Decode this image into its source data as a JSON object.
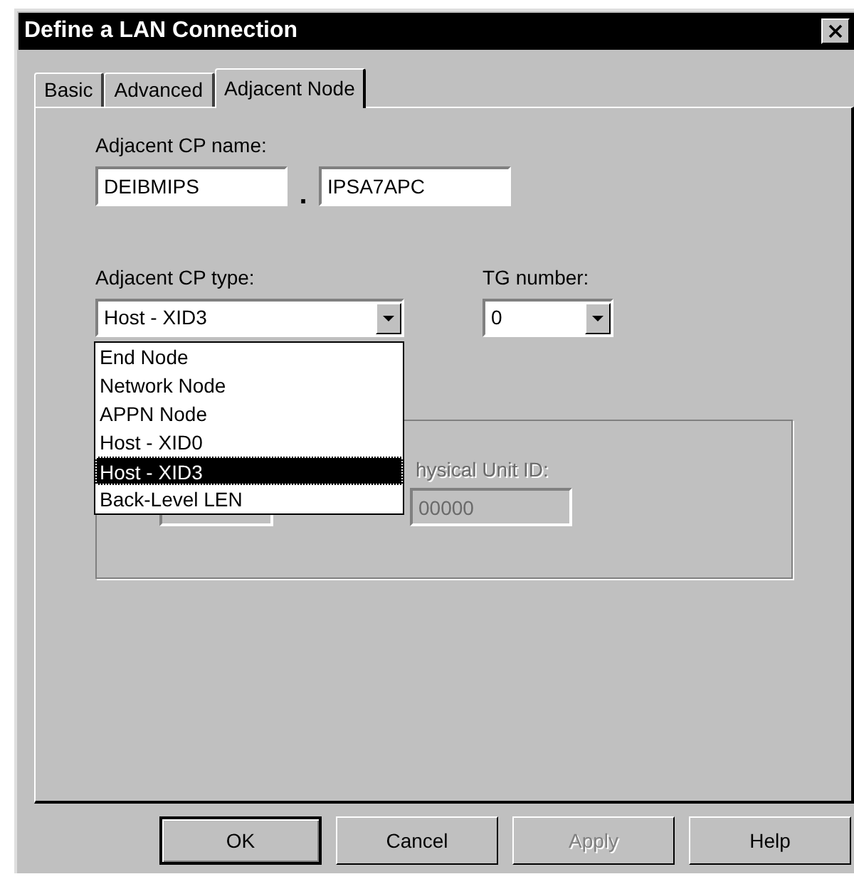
{
  "window": {
    "title": "Define a LAN Connection"
  },
  "tabs": [
    {
      "label": "Basic",
      "selected": false
    },
    {
      "label": "Advanced",
      "selected": false
    },
    {
      "label": "Adjacent Node",
      "selected": true
    }
  ],
  "cp_name": {
    "label": "Adjacent CP name:",
    "network": "DEIBMIPS",
    "separator": ".",
    "name": "IPSA7APC"
  },
  "cp_type": {
    "label": "Adjacent CP type:",
    "value": "Host - XID3",
    "expanded": true,
    "options": [
      {
        "label": "End Node",
        "selected": false
      },
      {
        "label": "Network Node",
        "selected": false
      },
      {
        "label": "APPN Node",
        "selected": false
      },
      {
        "label": "Host - XID0",
        "selected": false
      },
      {
        "label": "Host - XID3",
        "selected": true
      },
      {
        "label": "Back-Level LEN",
        "selected": false
      }
    ]
  },
  "tg_number": {
    "label": "TG number:",
    "value": "0"
  },
  "group": {
    "disabled": true,
    "label": "hysical Unit ID:",
    "fields": [
      "00000"
    ]
  },
  "buttons": [
    {
      "label": "OK",
      "default": true,
      "disabled": false
    },
    {
      "label": "Cancel",
      "default": false,
      "disabled": false
    },
    {
      "label": "Apply",
      "default": false,
      "disabled": true
    },
    {
      "label": "Help",
      "default": false,
      "disabled": false
    }
  ]
}
